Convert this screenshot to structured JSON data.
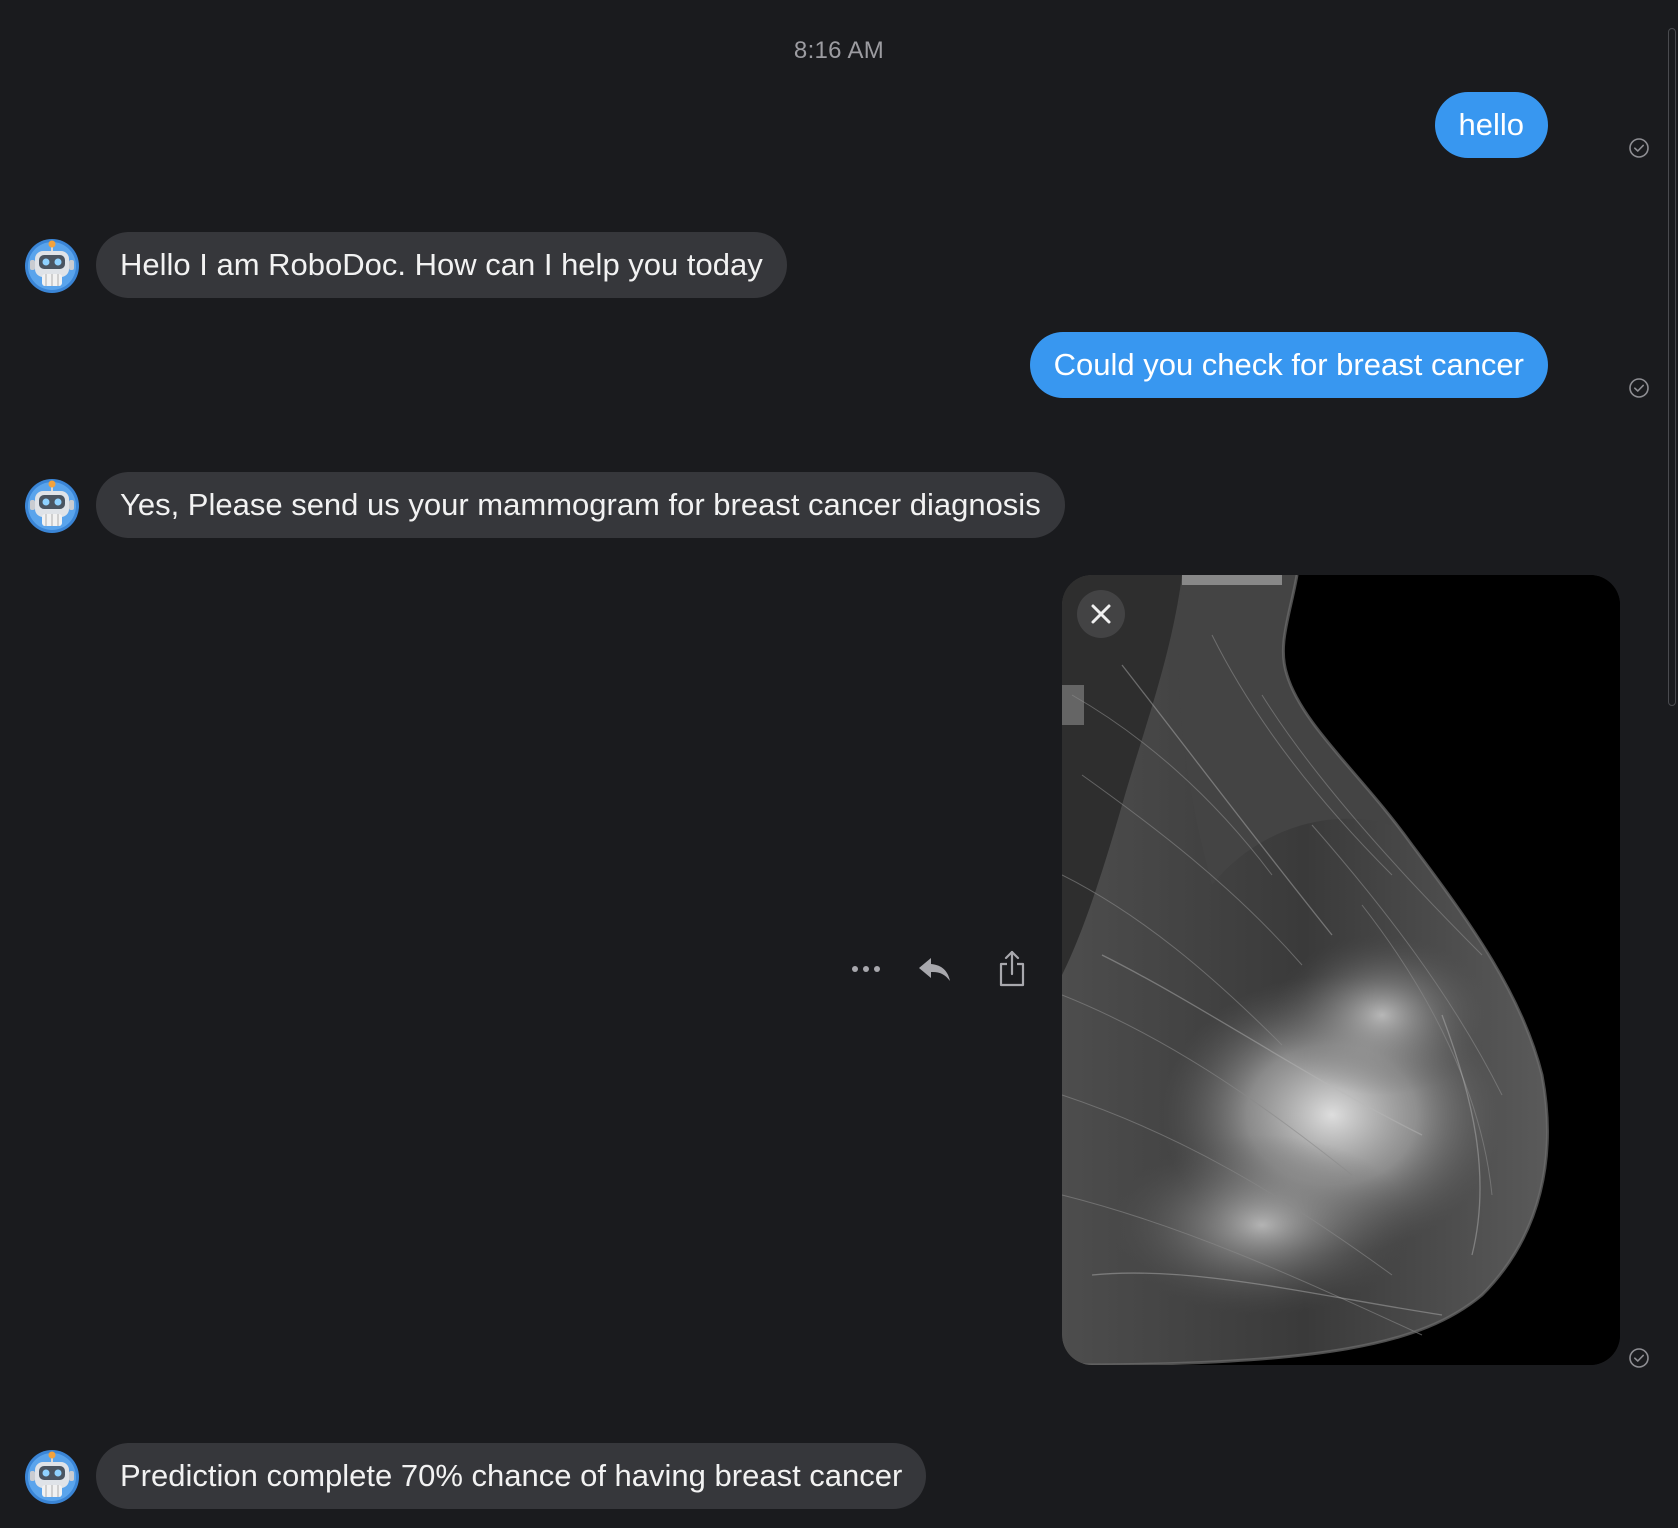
{
  "timestamp": "8:16 AM",
  "messages": [
    {
      "from": "user",
      "text": "hello",
      "status_icon": "read-check-icon"
    },
    {
      "from": "bot",
      "text": "Hello I am RoboDoc. How can I help you today",
      "avatar_icon": "robot-avatar-icon"
    },
    {
      "from": "user",
      "text": "Could you check for breast cancer",
      "status_icon": "read-check-icon"
    },
    {
      "from": "bot",
      "text": "Yes, Please send us your mammogram for breast cancer diagnosis",
      "avatar_icon": "robot-avatar-icon"
    },
    {
      "from": "user",
      "type": "image",
      "image_description_icon": "mammogram-image",
      "status_icon": "read-check-icon"
    },
    {
      "from": "bot",
      "text": "Prediction complete 70% chance of having breast cancer",
      "avatar_icon": "robot-avatar-icon"
    }
  ],
  "message_actions": [
    "more-icon",
    "reply-icon",
    "share-icon"
  ],
  "colors": {
    "background": "#1a1b1e",
    "outgoing_bubble": "#3897f0",
    "incoming_bubble": "#36373b",
    "timestamp_text": "#9c9ca1"
  }
}
